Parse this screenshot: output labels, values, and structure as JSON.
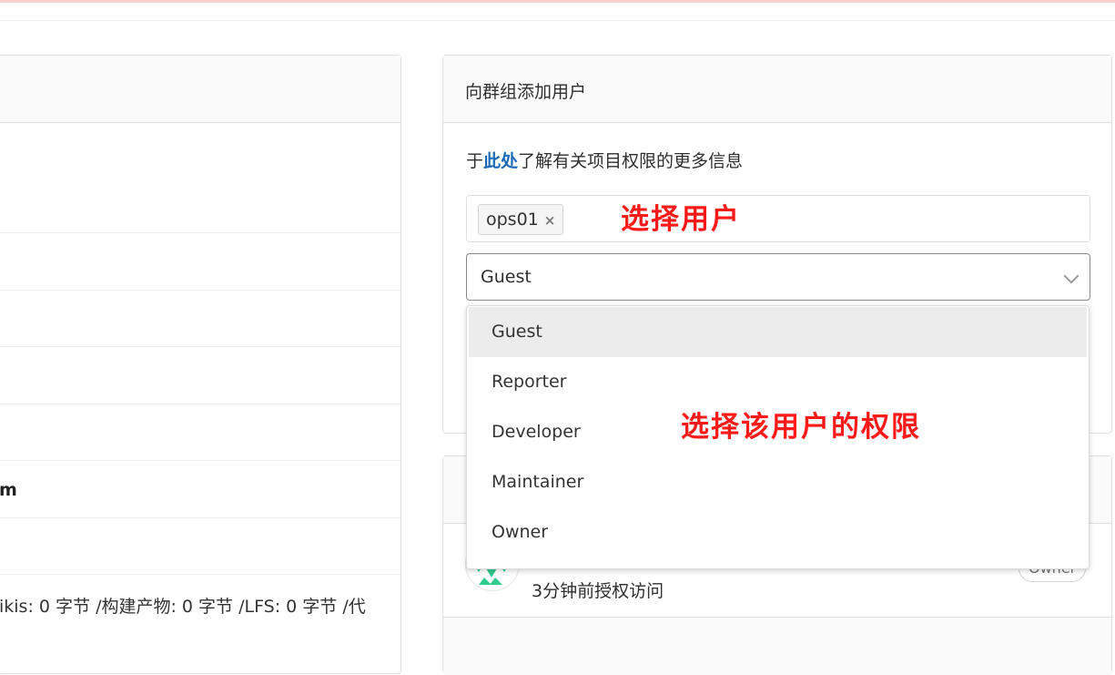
{
  "left": {
    "bold_fragment": "m",
    "stats_fragment": "ikis: 0 字节 /构建产物: 0 字节 /LFS: 0 字节 /代"
  },
  "add_user_panel": {
    "title": "向群组添加用户",
    "info_prefix": "于",
    "info_link": "此处",
    "info_suffix": "了解有关项目权限的更多信息",
    "selected_user": "ops01",
    "remove_icon": "×",
    "role_value": "Guest"
  },
  "role_options": [
    "Guest",
    "Reporter",
    "Developer",
    "Maintainer",
    "Owner"
  ],
  "annotations": {
    "select_user": "选择用户",
    "select_role": "选择该用户的权限"
  },
  "member": {
    "granted_text": "3分钟前授权访问",
    "role_badge": "Owner"
  },
  "colors": {
    "link": "#1b69b6",
    "annotation": "#ff1a1a",
    "selected_option_bg": "#ececec"
  }
}
